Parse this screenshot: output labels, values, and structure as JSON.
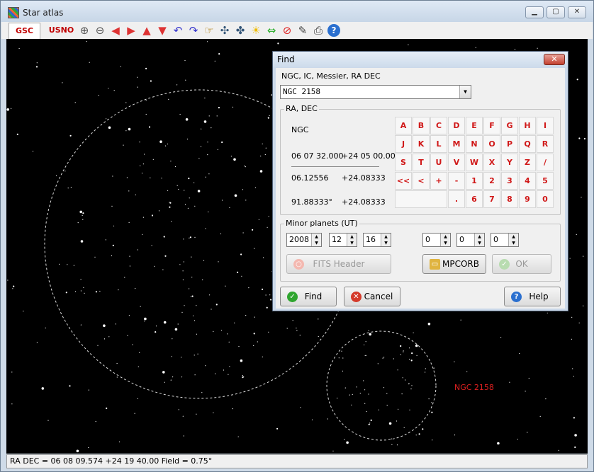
{
  "window": {
    "title": "Star atlas",
    "min": "▁",
    "max": "▢",
    "close": "✕"
  },
  "toolbar": {
    "tab_gsc": "GSC",
    "tab_usno": "USNO",
    "icons": [
      "zoom-in",
      "zoom-out",
      "arrow-left",
      "arrow-right",
      "arrow-up",
      "arrow-down",
      "rotate-left",
      "rotate-right",
      "hand",
      "chart-a",
      "chart-b",
      "sun",
      "swap",
      "stop",
      "wrench",
      "print",
      "help"
    ]
  },
  "sky": {
    "object_label": "NGC 2158"
  },
  "status": {
    "text": "RA DEC  =  06 08 09.574 +24 19 40.00  Field  = 0.75°"
  },
  "find": {
    "title": "Find",
    "close": "✕",
    "catalog_label": "NGC, IC, Messier,  RA DEC",
    "query_value": "NGC  2158",
    "radec_group": "RA, DEC",
    "object_type": "NGC",
    "coord_sexagesimal_ra": "06 07 32.000",
    "coord_sexagesimal_dec": "+24 05 00.00",
    "coord_hours_ra": "06.12556",
    "coord_hours_dec": "+24.08333",
    "coord_deg_ra": "91.88333°",
    "coord_deg_dec": "+24.08333",
    "keypad": [
      [
        "A",
        "B",
        "C",
        "D",
        "E",
        "F",
        "G",
        "H",
        "I"
      ],
      [
        "J",
        "K",
        "L",
        "M",
        "N",
        "O",
        "P",
        "Q",
        "R"
      ],
      [
        "S",
        "T",
        "U",
        "V",
        "W",
        "X",
        "Y",
        "Z",
        "/"
      ],
      [
        "<<",
        "<",
        "+",
        "-",
        "1",
        "2",
        "3",
        "4",
        "5"
      ],
      [
        "",
        "",
        "",
        ".",
        "6",
        "7",
        "8",
        "9",
        "0"
      ]
    ],
    "minor_planets_group": "Minor planets (UT)",
    "year": "2008",
    "month": "12",
    "day": "16",
    "hour": "0",
    "minute": "0",
    "second": "0",
    "fits_header_label": "FITS Header",
    "mpcorb_label": "MPCORB",
    "ok_label": "OK",
    "find_label": "Find",
    "cancel_label": "Cancel",
    "help_label": "Help"
  }
}
